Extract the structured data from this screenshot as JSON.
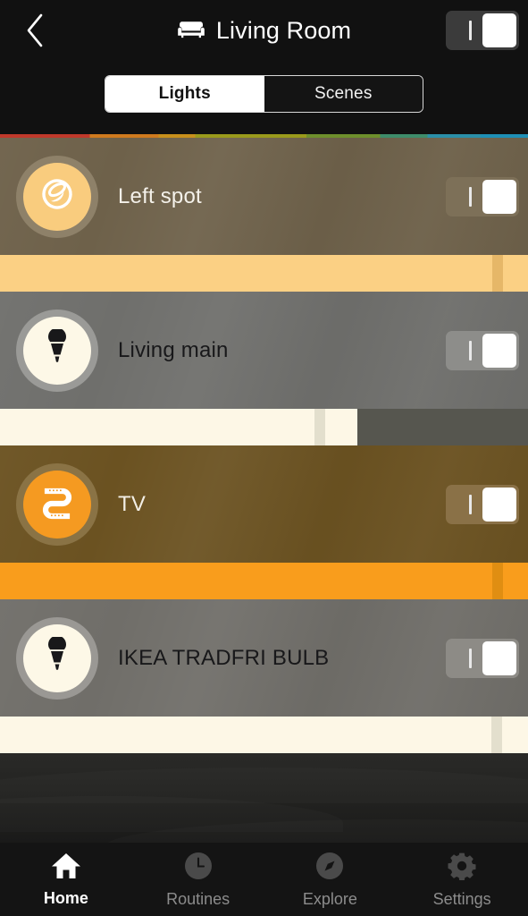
{
  "header": {
    "back_icon": "chevron-left-icon",
    "room_icon": "sofa-icon",
    "title": "Living Room",
    "toggle": {
      "state": "on",
      "symbol": "|",
      "track_color": "#3b3b3b",
      "knob_color": "#ffffff"
    }
  },
  "tabs": {
    "items": [
      {
        "label": "Lights",
        "active": true
      },
      {
        "label": "Scenes",
        "active": false
      }
    ]
  },
  "accent_rule": {
    "name": "rainbow-divider",
    "colors": [
      "#c0392b",
      "#cf7a1e",
      "#c8901c",
      "#9a9a1c",
      "#6e8f2c",
      "#3e8c6a",
      "#2b8fa8",
      "#1e8fb5"
    ]
  },
  "lights": [
    {
      "name": "Left spot",
      "icon": "spot-downlight-icon",
      "toggle_state": "on",
      "toggle_symbol": "|",
      "brightness_percent": 95,
      "row_bg": "#6e614a",
      "name_color": "#f4f1ea",
      "circle_ring": "#8e8169",
      "circle_fill": "#f9cc7e",
      "icon_color": "#ffffff",
      "toggle_track": "#7d7058",
      "slider_fill": "#fbd084",
      "slider_track": "#5d5c57",
      "slider_handle": "#e6b768"
    },
    {
      "name": "Living main",
      "icon": "bulb-spot-icon",
      "toggle_state": "on",
      "toggle_symbol": "|",
      "brightness_percent": 68,
      "row_bg": "#6f6f6c",
      "name_color": "#18181a",
      "circle_ring": "#9a9a97",
      "circle_fill": "#fdf8e7",
      "icon_color": "#18181a",
      "toggle_track": "#8d8d8a",
      "slider_fill": "#fdf7e6",
      "slider_track": "#56564f",
      "slider_handle": "#e3dfcd"
    },
    {
      "name": "TV",
      "icon": "lightstrip-icon",
      "toggle_state": "on",
      "toggle_symbol": "|",
      "brightness_percent": 100,
      "row_bg": "#6b5221",
      "name_color": "#f3efe6",
      "circle_ring": "#8a7345",
      "circle_fill": "#f59a21",
      "icon_color": "#ffffff",
      "toggle_track": "#8a7147",
      "slider_fill": "#f99d1c",
      "slider_track": "#5d5c57",
      "slider_handle": "#e08e12"
    },
    {
      "name": "IKEA TRADFRI BULB",
      "icon": "bulb-spot-icon",
      "toggle_state": "on",
      "toggle_symbol": "|",
      "brightness_percent": 100,
      "row_bg": "#706e69",
      "name_color": "#18181a",
      "circle_ring": "#9a9894",
      "circle_fill": "#fdf8e7",
      "icon_color": "#18181a",
      "toggle_track": "#8d8b86",
      "slider_fill": "#fdf7e6",
      "slider_track": "#56564f",
      "slider_handle": "#e3dfcd"
    }
  ],
  "bottom_nav": {
    "items": [
      {
        "label": "Home",
        "icon": "home-icon",
        "active": true
      },
      {
        "label": "Routines",
        "icon": "clock-icon",
        "active": false
      },
      {
        "label": "Explore",
        "icon": "compass-icon",
        "active": false
      },
      {
        "label": "Settings",
        "icon": "gear-icon",
        "active": false
      }
    ],
    "active_color": "#ffffff",
    "inactive_color": "#8c8c8c"
  }
}
